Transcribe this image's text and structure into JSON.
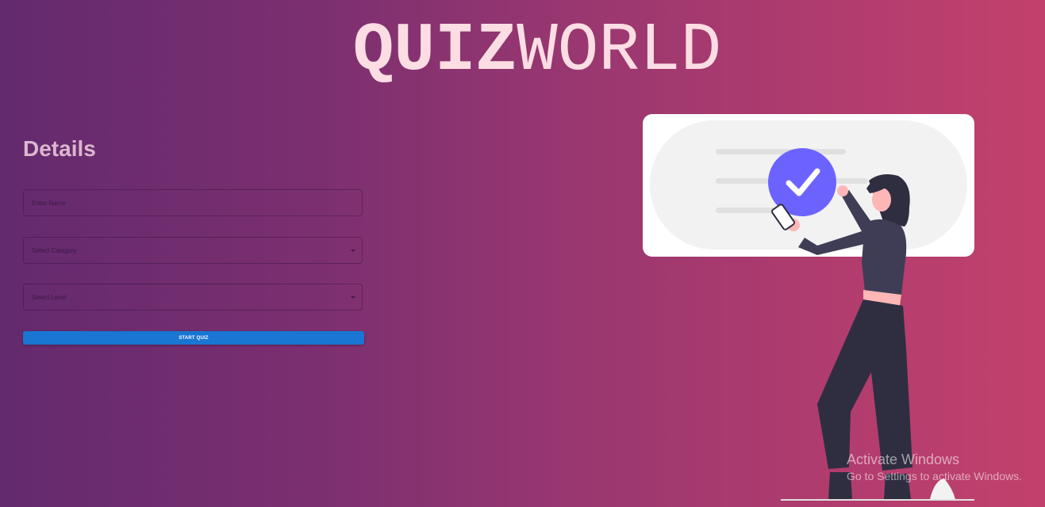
{
  "header": {
    "title_bold": "QUIZ",
    "title_light": "WORLD"
  },
  "form": {
    "heading": "Details",
    "name_placeholder": "Enter Name",
    "category_placeholder": "Select Category",
    "level_placeholder": "Select Level",
    "start_label": "START QUIZ"
  },
  "illustration": {
    "name": "person-checking-quiz-illustration"
  },
  "watermark": {
    "title": "Activate Windows",
    "subtitle": "Go to Settings to activate Windows."
  },
  "colors": {
    "background_left": "#632a6e",
    "background_right": "#c2416c",
    "title": "#fcdde3",
    "heading": "#dcb6cf",
    "button": "#1976d2",
    "check_badge": "#6c63ff"
  }
}
